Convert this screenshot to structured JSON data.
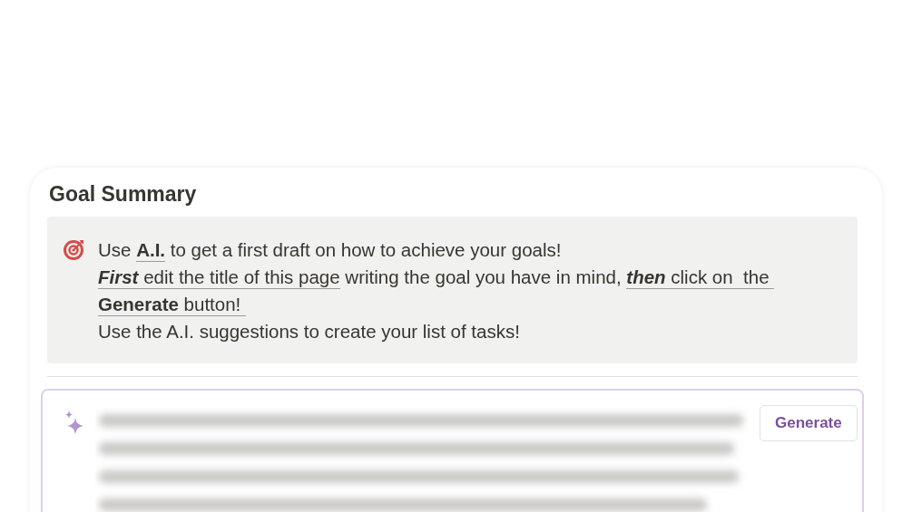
{
  "section": {
    "title": "Goal Summary"
  },
  "callout": {
    "paragraphs": [
      [
        {
          "text": "Use ",
          "bold": false,
          "italic": false,
          "underline": false
        },
        {
          "text": "A.I.",
          "bold": true,
          "italic": false,
          "underline": true
        },
        {
          "text": " to get a first draft on how to achieve your goals!",
          "bold": false,
          "italic": false,
          "underline": false
        }
      ],
      [
        {
          "text": "First",
          "bold": true,
          "italic": true,
          "underline": true
        },
        {
          "text": " edit the title of this page",
          "bold": false,
          "italic": false,
          "underline": true
        },
        {
          "text": " writing the goal you have in mind, ",
          "bold": false,
          "italic": false,
          "underline": false
        },
        {
          "text": "then",
          "bold": true,
          "italic": true,
          "underline": true
        },
        {
          "text": " click on  the ",
          "bold": false,
          "italic": false,
          "underline": true
        },
        {
          "text": "Generate",
          "bold": true,
          "italic": false,
          "underline": true
        },
        {
          "text": " button! ",
          "bold": false,
          "italic": false,
          "underline": true
        }
      ],
      [
        {
          "text": "Use the A.I. suggestions to create your list of tasks!",
          "bold": false,
          "italic": false,
          "underline": false
        }
      ]
    ]
  },
  "ai_block": {
    "button": "Generate"
  }
}
